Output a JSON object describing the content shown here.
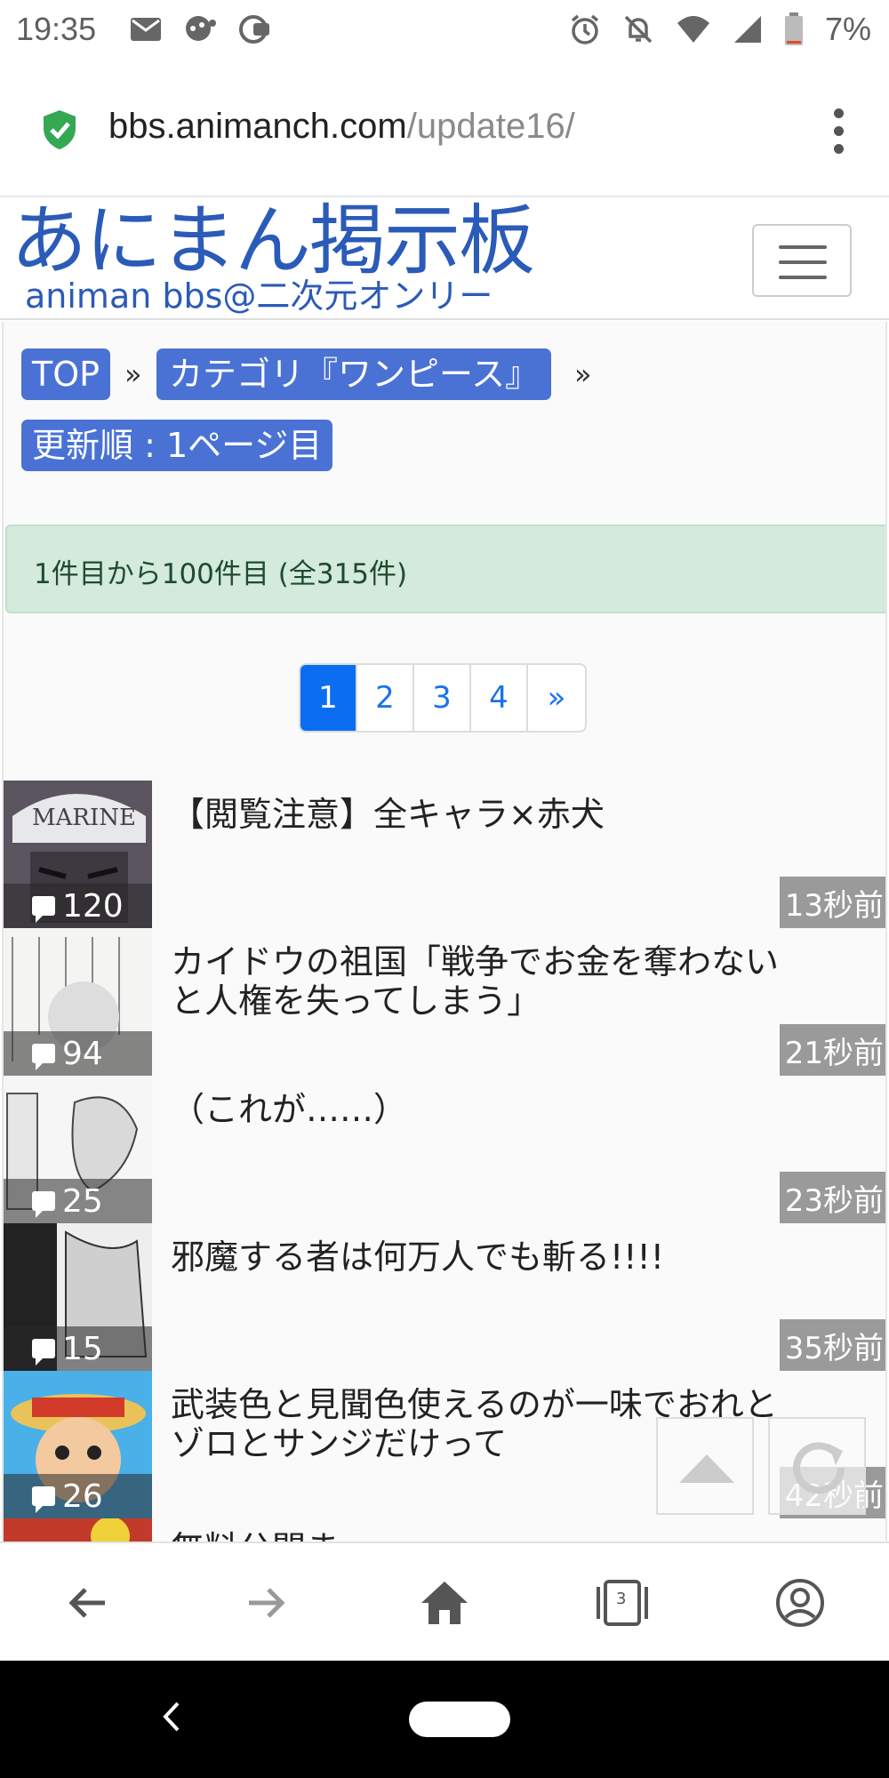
{
  "status_bar": {
    "time": "19:35",
    "battery": "7%"
  },
  "browser": {
    "url_domain": "bbs.animanch.com",
    "url_path": "/update16/",
    "tab_count": "3"
  },
  "site": {
    "logo_main": "あにまん掲示板",
    "logo_sub": "animan bbs@二次元オンリー"
  },
  "breadcrumb": {
    "top": "TOP",
    "separator": "»",
    "category": "カテゴリ『ワンピース』",
    "current": "更新順 : 1ページ目"
  },
  "result_info": "1件目から100件目 (全315件)",
  "pagination": {
    "pages": [
      "1",
      "2",
      "3",
      "4"
    ],
    "next": "»"
  },
  "threads": [
    {
      "title": "【閲覧注意】全キャラ×赤犬",
      "count": "120",
      "time": "13秒前"
    },
    {
      "title": "カイドウの祖国「戦争でお金を奪わないと人権を失ってしまう」",
      "count": "94",
      "time": "21秒前"
    },
    {
      "title": "（これが……）",
      "count": "25",
      "time": "23秒前"
    },
    {
      "title": "邪魔する者は何万人でも斬る!!!!",
      "count": "15",
      "time": "35秒前"
    },
    {
      "title": "武装色と見聞色使えるのが一味でおれとゾロとサンジだけって",
      "count": "26",
      "time": "42秒前"
    },
    {
      "title": "無料公開ま…",
      "count": "",
      "time": ""
    }
  ],
  "colors": {
    "accent": "#4a72d5",
    "logo": "#2b5bb8",
    "alert_bg": "#d3eadc",
    "page_active": "#0b6ef0"
  }
}
